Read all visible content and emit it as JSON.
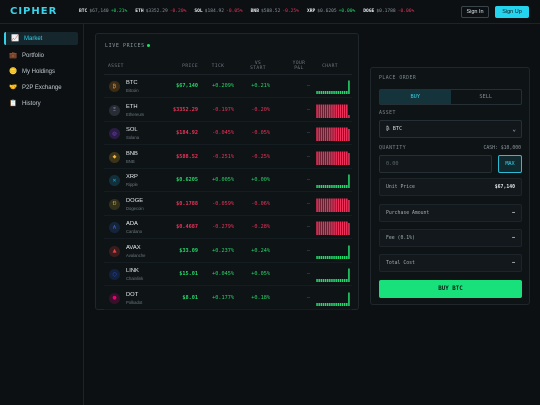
{
  "brand": {
    "logo": "CIPHER",
    "accent": "#39d3ea"
  },
  "ticker": [
    {
      "symbol": "BTC",
      "price": "$67,140",
      "change": "+0.21%",
      "dir": "up"
    },
    {
      "symbol": "ETH",
      "price": "$3352.29",
      "change": "-0.20%",
      "dir": "down"
    },
    {
      "symbol": "SOL",
      "price": "$184.92",
      "change": "-0.05%",
      "dir": "down"
    },
    {
      "symbol": "BNB",
      "price": "$588.52",
      "change": "-0.25%",
      "dir": "down"
    },
    {
      "symbol": "XRP",
      "price": "$0.6205",
      "change": "+0.00%",
      "dir": "up"
    },
    {
      "symbol": "DOGE",
      "price": "$0.1788",
      "change": "-0.06%",
      "dir": "down"
    }
  ],
  "auth": {
    "signin": "Sign In",
    "signup": "Sign Up"
  },
  "sidebar": {
    "items": [
      {
        "label": "Market",
        "icon": "chart-icon",
        "glyph": "📈",
        "active": true
      },
      {
        "label": "Portfolio",
        "icon": "briefcase-icon",
        "glyph": "💼",
        "active": false
      },
      {
        "label": "My Holdings",
        "icon": "coin-icon",
        "glyph": "🪙",
        "active": false
      },
      {
        "label": "P2P Exchange",
        "icon": "handshake-icon",
        "glyph": "🤝",
        "active": false
      },
      {
        "label": "History",
        "icon": "clipboard-icon",
        "glyph": "📋",
        "active": false
      }
    ]
  },
  "prices": {
    "title": "LIVE PRICES",
    "headers": {
      "asset": "ASSET",
      "price": "PRICE",
      "tick": "TICK",
      "vs": "VS START",
      "pnl": "YOUR P&L",
      "chart": "CHART"
    },
    "rows": [
      {
        "symbol": "BTC",
        "name": "Bitcoin",
        "price": "$67,140",
        "tick": "+0.209%",
        "vs": "+0.21%",
        "pnl": "—",
        "dir": "up",
        "glyph": "₿",
        "color": "#f7931a",
        "spark": [
          2,
          2,
          2,
          2,
          2,
          2,
          2,
          2,
          2,
          2,
          2,
          2,
          2,
          2,
          2,
          9
        ]
      },
      {
        "symbol": "ETH",
        "name": "Ethereum",
        "price": "$3352.29",
        "tick": "-0.197%",
        "vs": "-0.20%",
        "pnl": "—",
        "dir": "down",
        "glyph": "Ξ",
        "color": "#8a92b2",
        "spark": [
          9,
          9,
          9,
          9,
          9,
          9,
          9,
          9,
          9,
          9,
          9,
          9,
          9,
          9,
          9,
          2
        ]
      },
      {
        "symbol": "SOL",
        "name": "Solana",
        "price": "$184.92",
        "tick": "-0.045%",
        "vs": "-0.05%",
        "pnl": "—",
        "dir": "down",
        "glyph": "◎",
        "color": "#9945ff",
        "spark": [
          9,
          9,
          9,
          9,
          9,
          9,
          9,
          9,
          9,
          9,
          9,
          9,
          9,
          9,
          9,
          8
        ]
      },
      {
        "symbol": "BNB",
        "name": "BNB",
        "price": "$588.52",
        "tick": "-0.251%",
        "vs": "-0.25%",
        "pnl": "—",
        "dir": "down",
        "glyph": "◆",
        "color": "#f3ba2f",
        "spark": [
          9,
          9,
          9,
          9,
          9,
          9,
          9,
          9,
          9,
          9,
          9,
          9,
          9,
          9,
          9,
          8
        ]
      },
      {
        "symbol": "XRP",
        "name": "Ripple",
        "price": "$0.6205",
        "tick": "+0.005%",
        "vs": "+0.00%",
        "pnl": "—",
        "dir": "up",
        "glyph": "✕",
        "color": "#23a6d5",
        "spark": [
          2,
          2,
          2,
          2,
          2,
          2,
          2,
          2,
          2,
          2,
          2,
          2,
          2,
          2,
          2,
          9
        ]
      },
      {
        "symbol": "DOGE",
        "name": "Dogecoin",
        "price": "$0.1788",
        "tick": "-0.059%",
        "vs": "-0.06%",
        "pnl": "—",
        "dir": "down",
        "glyph": "Ð",
        "color": "#c2a633",
        "spark": [
          9,
          9,
          9,
          9,
          9,
          9,
          9,
          9,
          9,
          9,
          9,
          9,
          9,
          9,
          9,
          8
        ]
      },
      {
        "symbol": "ADA",
        "name": "Cardano",
        "price": "$0.4687",
        "tick": "-0.279%",
        "vs": "-0.28%",
        "pnl": "—",
        "dir": "down",
        "glyph": "₳",
        "color": "#3468d1",
        "spark": [
          9,
          9,
          9,
          9,
          9,
          9,
          9,
          9,
          9,
          9,
          9,
          9,
          9,
          9,
          9,
          8
        ]
      },
      {
        "symbol": "AVAX",
        "name": "Avalanche",
        "price": "$33.09",
        "tick": "+0.237%",
        "vs": "+0.24%",
        "pnl": "—",
        "dir": "up",
        "glyph": "▲",
        "color": "#e84142",
        "spark": [
          2,
          2,
          2,
          2,
          2,
          2,
          2,
          2,
          2,
          2,
          2,
          2,
          2,
          2,
          2,
          9
        ]
      },
      {
        "symbol": "LINK",
        "name": "Chainlink",
        "price": "$15.01",
        "tick": "+0.045%",
        "vs": "+0.05%",
        "pnl": "—",
        "dir": "up",
        "glyph": "⬡",
        "color": "#2a5ada",
        "spark": [
          2,
          2,
          2,
          2,
          2,
          2,
          2,
          2,
          2,
          2,
          2,
          2,
          2,
          2,
          2,
          9
        ]
      },
      {
        "symbol": "DOT",
        "name": "Polkadot",
        "price": "$8.01",
        "tick": "+0.177%",
        "vs": "+0.18%",
        "pnl": "—",
        "dir": "up",
        "glyph": "●",
        "color": "#e6007a",
        "spark": [
          2,
          2,
          2,
          2,
          2,
          2,
          2,
          2,
          2,
          2,
          2,
          2,
          2,
          2,
          2,
          9
        ]
      }
    ]
  },
  "order": {
    "title": "PLACE ORDER",
    "buy_tab": "BUY",
    "sell_tab": "SELL",
    "asset_label": "ASSET",
    "asset_value": "₿ BTC",
    "quantity_label": "QUANTITY",
    "cash": "CASH: $10,000",
    "quantity_placeholder": "0.00",
    "max": "MAX",
    "unit_price_label": "Unit Price",
    "unit_price": "$67,140",
    "purchase_amount_label": "Purchase Amount",
    "purchase_amount": "—",
    "fee_label": "Fee (0.1%)",
    "fee": "—",
    "total_label": "Total Cost",
    "total": "—",
    "submit": "BUY BTC"
  },
  "colors": {
    "up": "#25d96a",
    "down": "#f0325a",
    "buy": "#18e07a"
  }
}
